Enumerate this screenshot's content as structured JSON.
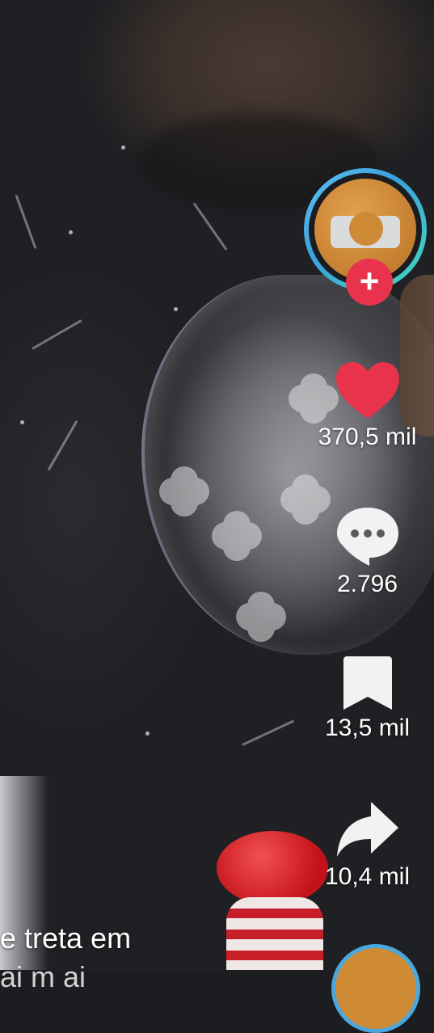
{
  "actions": {
    "follow_label": "+",
    "likes": "370,5 mil",
    "comments": "2.796",
    "saves": "13,5 mil",
    "shares": "10,4 mil"
  },
  "caption": {
    "line1": "e treta em",
    "line2": "   ai         m    ai"
  },
  "icons": {
    "like": "heart-icon",
    "comment": "comment-bubble-icon",
    "save": "bookmark-icon",
    "share": "share-arrow-icon"
  },
  "colors": {
    "like": "#e9334d",
    "follow": "#e9334d",
    "ring_start": "#5fc3f0",
    "ring_end": "#43d8b8",
    "icon_white": "#f2f2f2"
  }
}
